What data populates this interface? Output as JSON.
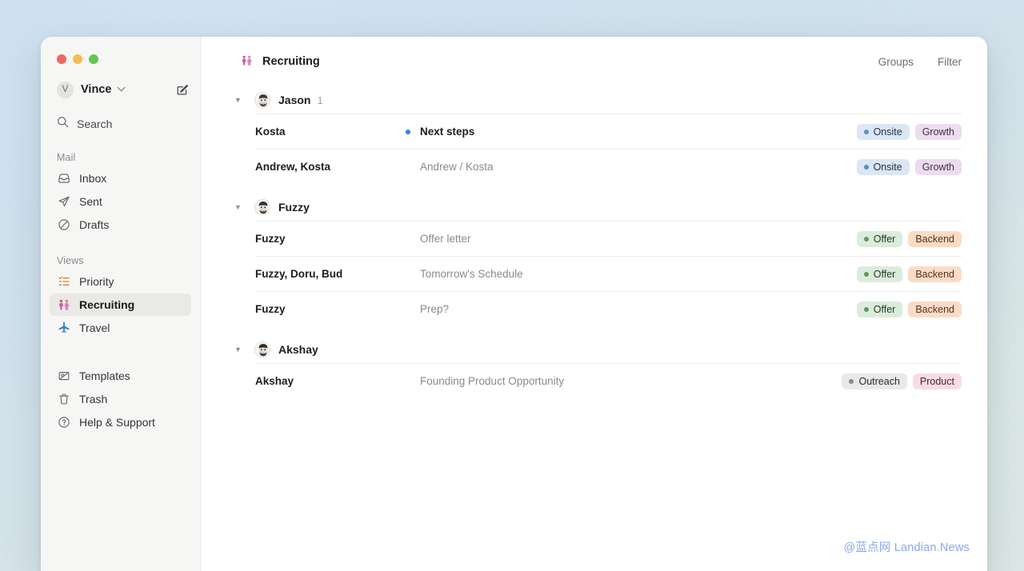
{
  "window": {
    "traffic_lights": [
      "close",
      "minimize",
      "zoom"
    ]
  },
  "sidebar": {
    "account": {
      "initial": "V",
      "name": "Vince",
      "chevron": "⌄",
      "compose_icon": "compose-icon"
    },
    "search": {
      "label": "Search",
      "icon": "search-icon"
    },
    "sections": [
      {
        "label": "Mail",
        "items": [
          {
            "label": "Inbox",
            "icon": "inbox-icon",
            "active": false
          },
          {
            "label": "Sent",
            "icon": "send-icon",
            "active": false
          },
          {
            "label": "Drafts",
            "icon": "drafts-icon",
            "active": false
          }
        ]
      },
      {
        "label": "Views",
        "items": [
          {
            "label": "Priority",
            "icon": "priority-list-icon",
            "active": false
          },
          {
            "label": "Recruiting",
            "icon": "people-icon",
            "active": true
          },
          {
            "label": "Travel",
            "icon": "airplane-icon",
            "active": false
          }
        ]
      }
    ],
    "footer_items": [
      {
        "label": "Templates",
        "icon": "templates-icon"
      },
      {
        "label": "Trash",
        "icon": "trash-icon"
      },
      {
        "label": "Help & Support",
        "icon": "help-circle-icon"
      }
    ]
  },
  "header": {
    "view_icon": "people-icon",
    "view_title": "Recruiting",
    "actions": [
      {
        "label": "Groups"
      },
      {
        "label": "Filter"
      }
    ]
  },
  "tag_colors": {
    "onsite": {
      "bg": "#dce7f5",
      "fg": "#1f3044",
      "dot": "#5b8fc4"
    },
    "growth": {
      "bg": "#ecdcee",
      "fg": "#4a2a50",
      "dot": ""
    },
    "offer": {
      "bg": "#dcecdc",
      "fg": "#1f3a22",
      "dot": "#5a9a5f"
    },
    "backend": {
      "bg": "#fadcc6",
      "fg": "#5c3218",
      "dot": ""
    },
    "outreach": {
      "bg": "#e9e9e7",
      "fg": "#2c2c2e",
      "dot": "#8a8a8e"
    },
    "product": {
      "bg": "#f7dce6",
      "fg": "#4d1f32",
      "dot": ""
    }
  },
  "groups": [
    {
      "name": "Jason",
      "count": "1",
      "avatar": "person-photo",
      "expanded": true,
      "disclosure": "▼",
      "rows": [
        {
          "people": "Kosta",
          "subject": "Next steps",
          "unread": true,
          "tags": [
            {
              "label": "Onsite",
              "style": "onsite"
            },
            {
              "label": "Growth",
              "style": "growth"
            }
          ]
        },
        {
          "people": "Andrew, Kosta",
          "subject": "Andrew / Kosta",
          "unread": false,
          "tags": [
            {
              "label": "Onsite",
              "style": "onsite"
            },
            {
              "label": "Growth",
              "style": "growth"
            }
          ]
        }
      ]
    },
    {
      "name": "Fuzzy",
      "count": "",
      "avatar": "person-photo",
      "expanded": true,
      "disclosure": "▼",
      "rows": [
        {
          "people": "Fuzzy",
          "subject": "Offer letter",
          "unread": false,
          "tags": [
            {
              "label": "Offer",
              "style": "offer"
            },
            {
              "label": "Backend",
              "style": "backend"
            }
          ]
        },
        {
          "people": "Fuzzy, Doru, Bud",
          "subject": "Tomorrow's Schedule",
          "unread": false,
          "tags": [
            {
              "label": "Offer",
              "style": "offer"
            },
            {
              "label": "Backend",
              "style": "backend"
            }
          ]
        },
        {
          "people": "Fuzzy",
          "subject": "Prep?",
          "unread": false,
          "tags": [
            {
              "label": "Offer",
              "style": "offer"
            },
            {
              "label": "Backend",
              "style": "backend"
            }
          ]
        }
      ]
    },
    {
      "name": "Akshay",
      "count": "",
      "avatar": "person-photo",
      "expanded": true,
      "disclosure": "▼",
      "rows": [
        {
          "people": "Akshay",
          "subject": "Founding Product Opportunity",
          "unread": false,
          "tags": [
            {
              "label": "Outreach",
              "style": "outreach"
            },
            {
              "label": "Product",
              "style": "product"
            }
          ]
        }
      ]
    }
  ],
  "watermark": "@蓝点网 Landian.News"
}
